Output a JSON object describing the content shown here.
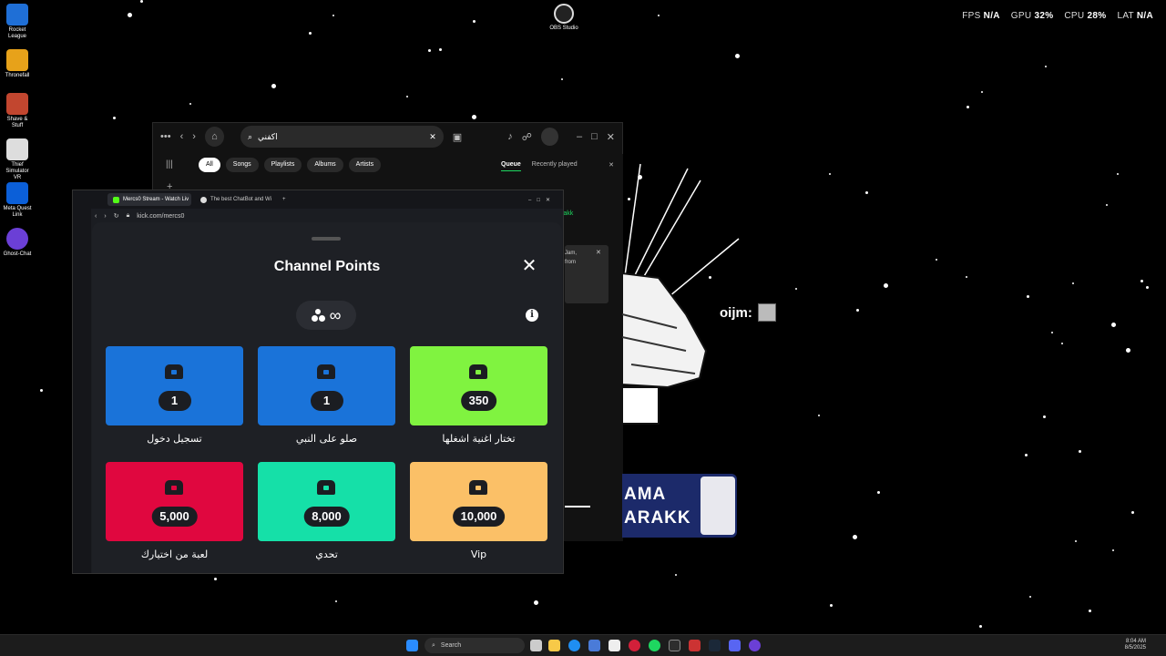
{
  "desktop": {
    "icons": [
      {
        "label": "Rocket League"
      },
      {
        "label": "Thronefall"
      },
      {
        "label": "Shave & Stuff"
      },
      {
        "label": "Thief Simulator VR"
      },
      {
        "label": "Meta Quest Link"
      },
      {
        "label": "Ghost-Chat"
      }
    ],
    "obs_label": "OBS Studio"
  },
  "perf": {
    "fps_label": "FPS",
    "fps_value": "N/A",
    "gpu_label": "GPU",
    "gpu_value": "32",
    "cpu_label": "CPU",
    "cpu_value": "28",
    "lat_label": "LAT",
    "lat_value": "N/A"
  },
  "spotify": {
    "search_value": "اكفني",
    "chips": [
      "All",
      "Songs",
      "Playlists",
      "Albums",
      "Artists"
    ],
    "queue_tab": "Queue",
    "recent_tab": "Recently played",
    "queue_snippet_1": "rakk",
    "queue_snippet_2": "Jam,",
    "queue_snippet_3": "from"
  },
  "browser": {
    "tabs": [
      {
        "title": "Mercs0 Stream - Watch Liv"
      },
      {
        "title": "The best ChatBot and Wi"
      }
    ],
    "url": "kick.com/mercs0"
  },
  "modal": {
    "title": "Channel Points",
    "close_glyph": "✕",
    "points_value": "∞",
    "info_glyph": "i",
    "rewards": [
      {
        "cost": "1",
        "label": "تسجيل دخول",
        "color": "#1a73d9"
      },
      {
        "cost": "1",
        "label": "صلو على النبي",
        "color": "#1a73d9"
      },
      {
        "cost": "350",
        "label": "تختار اغنية اشغلها",
        "color": "#80f340"
      },
      {
        "cost": "5,000",
        "label": "لعبة من اختيارك",
        "color": "#e0073f"
      },
      {
        "cost": "8,000",
        "label": "تحدي",
        "color": "#15e0a8"
      },
      {
        "cost": "10,000",
        "label": "Vip",
        "color": "#fbc067"
      }
    ]
  },
  "overlay": {
    "chat_user": "oijm:",
    "banner_line1": "AMA",
    "banner_line2": "ARAKK"
  },
  "taskbar": {
    "search_placeholder": "Search",
    "time": "8:04 AM",
    "date": "8/5/2025"
  }
}
